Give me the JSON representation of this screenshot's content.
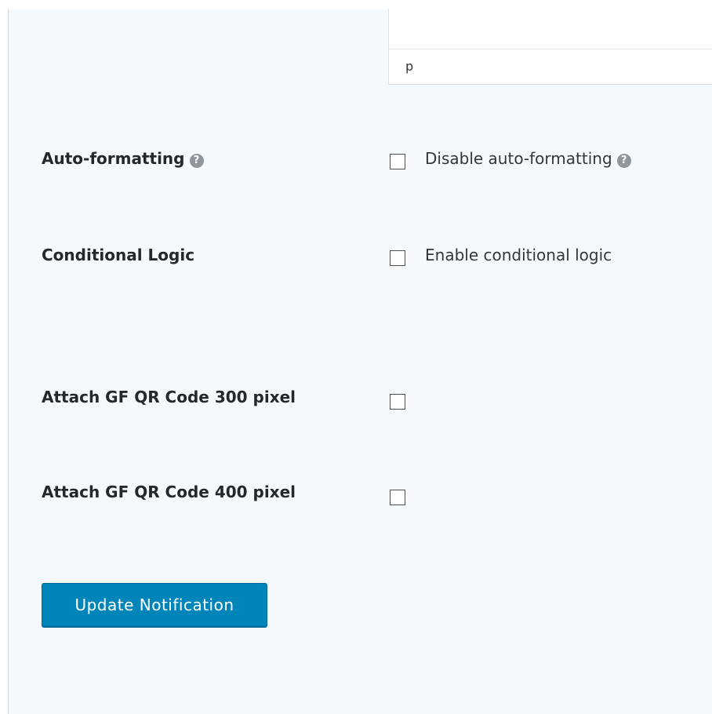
{
  "editor": {
    "path_text": "p"
  },
  "rows": {
    "autoformat": {
      "label": "Auto-formatting",
      "help_glyph": "?",
      "checkbox_label": "Disable auto-formatting",
      "checkbox_help_glyph": "?",
      "checked": false
    },
    "conditional": {
      "label": "Conditional Logic",
      "checkbox_label": "Enable conditional logic",
      "checked": false
    },
    "qr300": {
      "label": "Attach GF QR Code 300 pixel",
      "checked": false
    },
    "qr400": {
      "label": "Attach GF QR Code 400 pixel",
      "checked": false
    }
  },
  "actions": {
    "update_label": "Update Notification"
  },
  "colors": {
    "panel_bg": "#f5f9fc",
    "button_bg": "#0085ba",
    "help_icon": "#8f969c"
  }
}
